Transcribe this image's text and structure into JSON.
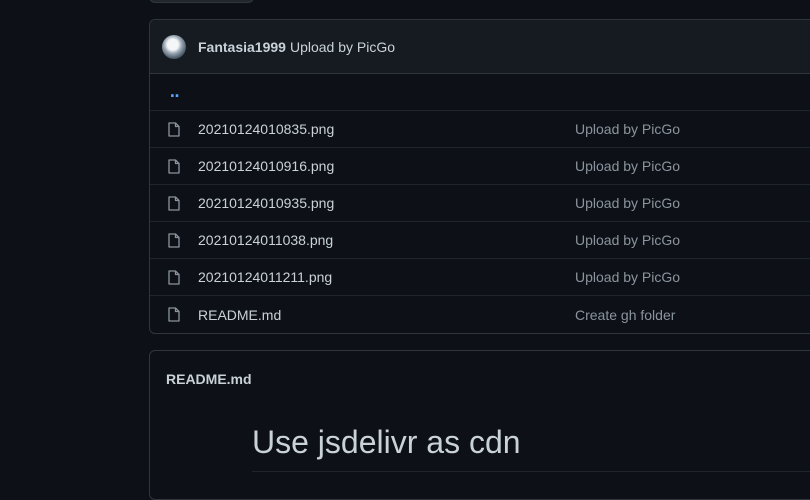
{
  "latest_commit": {
    "author": "Fantasia1999",
    "message": "Upload by PicGo"
  },
  "parent_link": "‥",
  "files": [
    {
      "name": "20210124010835.png",
      "message": "Upload by PicGo",
      "icon": "file-icon"
    },
    {
      "name": "20210124010916.png",
      "message": "Upload by PicGo",
      "icon": "file-icon"
    },
    {
      "name": "20210124010935.png",
      "message": "Upload by PicGo",
      "icon": "file-icon"
    },
    {
      "name": "20210124011038.png",
      "message": "Upload by PicGo",
      "icon": "file-icon"
    },
    {
      "name": "20210124011211.png",
      "message": "Upload by PicGo",
      "icon": "file-icon"
    },
    {
      "name": "README.md",
      "message": "Create gh folder",
      "icon": "file-icon"
    }
  ],
  "readme": {
    "filename": "README.md",
    "heading": "Use jsdelivr as cdn"
  },
  "colors": {
    "background": "#0d1117",
    "header_bg": "#161b22",
    "border": "#30363d",
    "link": "#58a6ff",
    "muted": "#8b949e",
    "text": "#c9d1d9"
  }
}
